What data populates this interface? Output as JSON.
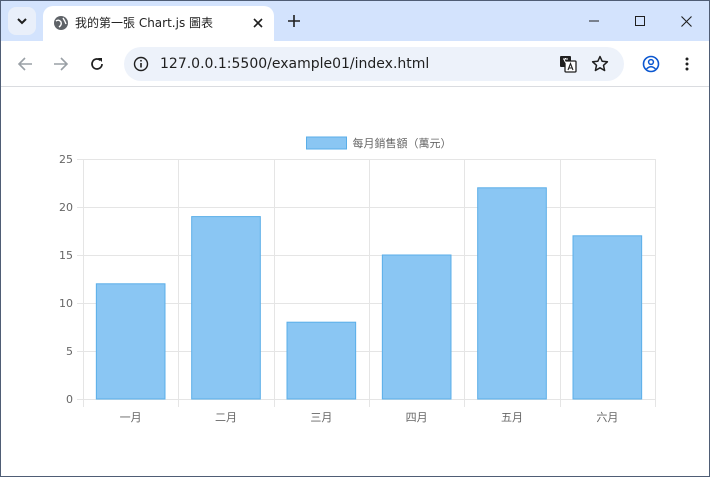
{
  "browser": {
    "tab_title": "我的第一張 Chart.js 圖表",
    "url": "127.0.0.1:5500/example01/index.html"
  },
  "icons": {
    "tab_search": "chevron-down-icon",
    "favicon": "globe-icon",
    "tab_close": "close-icon",
    "new_tab": "plus-icon",
    "minimize": "minimize-icon",
    "maximize": "maximize-icon",
    "window_close": "close-icon",
    "back": "arrow-left-icon",
    "forward": "arrow-right-icon",
    "reload": "reload-icon",
    "site_info": "info-icon",
    "translate": "translate-icon",
    "bookmark": "star-icon",
    "profile": "profile-icon",
    "menu": "kebab-menu-icon"
  },
  "chart_data": {
    "type": "bar",
    "categories": [
      "一月",
      "二月",
      "三月",
      "四月",
      "五月",
      "六月"
    ],
    "series": [
      {
        "name": "每月銷售額（萬元）",
        "values": [
          12,
          19,
          8,
          15,
          22,
          17
        ]
      }
    ],
    "ylim": [
      0,
      25
    ],
    "yticks": [
      0,
      5,
      10,
      15,
      20,
      25
    ],
    "grid": true,
    "legend_position": "top",
    "colors": {
      "bar_fill": "#8ac6f3",
      "bar_border": "#5aaee8",
      "grid": "#e5e5e5",
      "text": "#666666"
    }
  }
}
